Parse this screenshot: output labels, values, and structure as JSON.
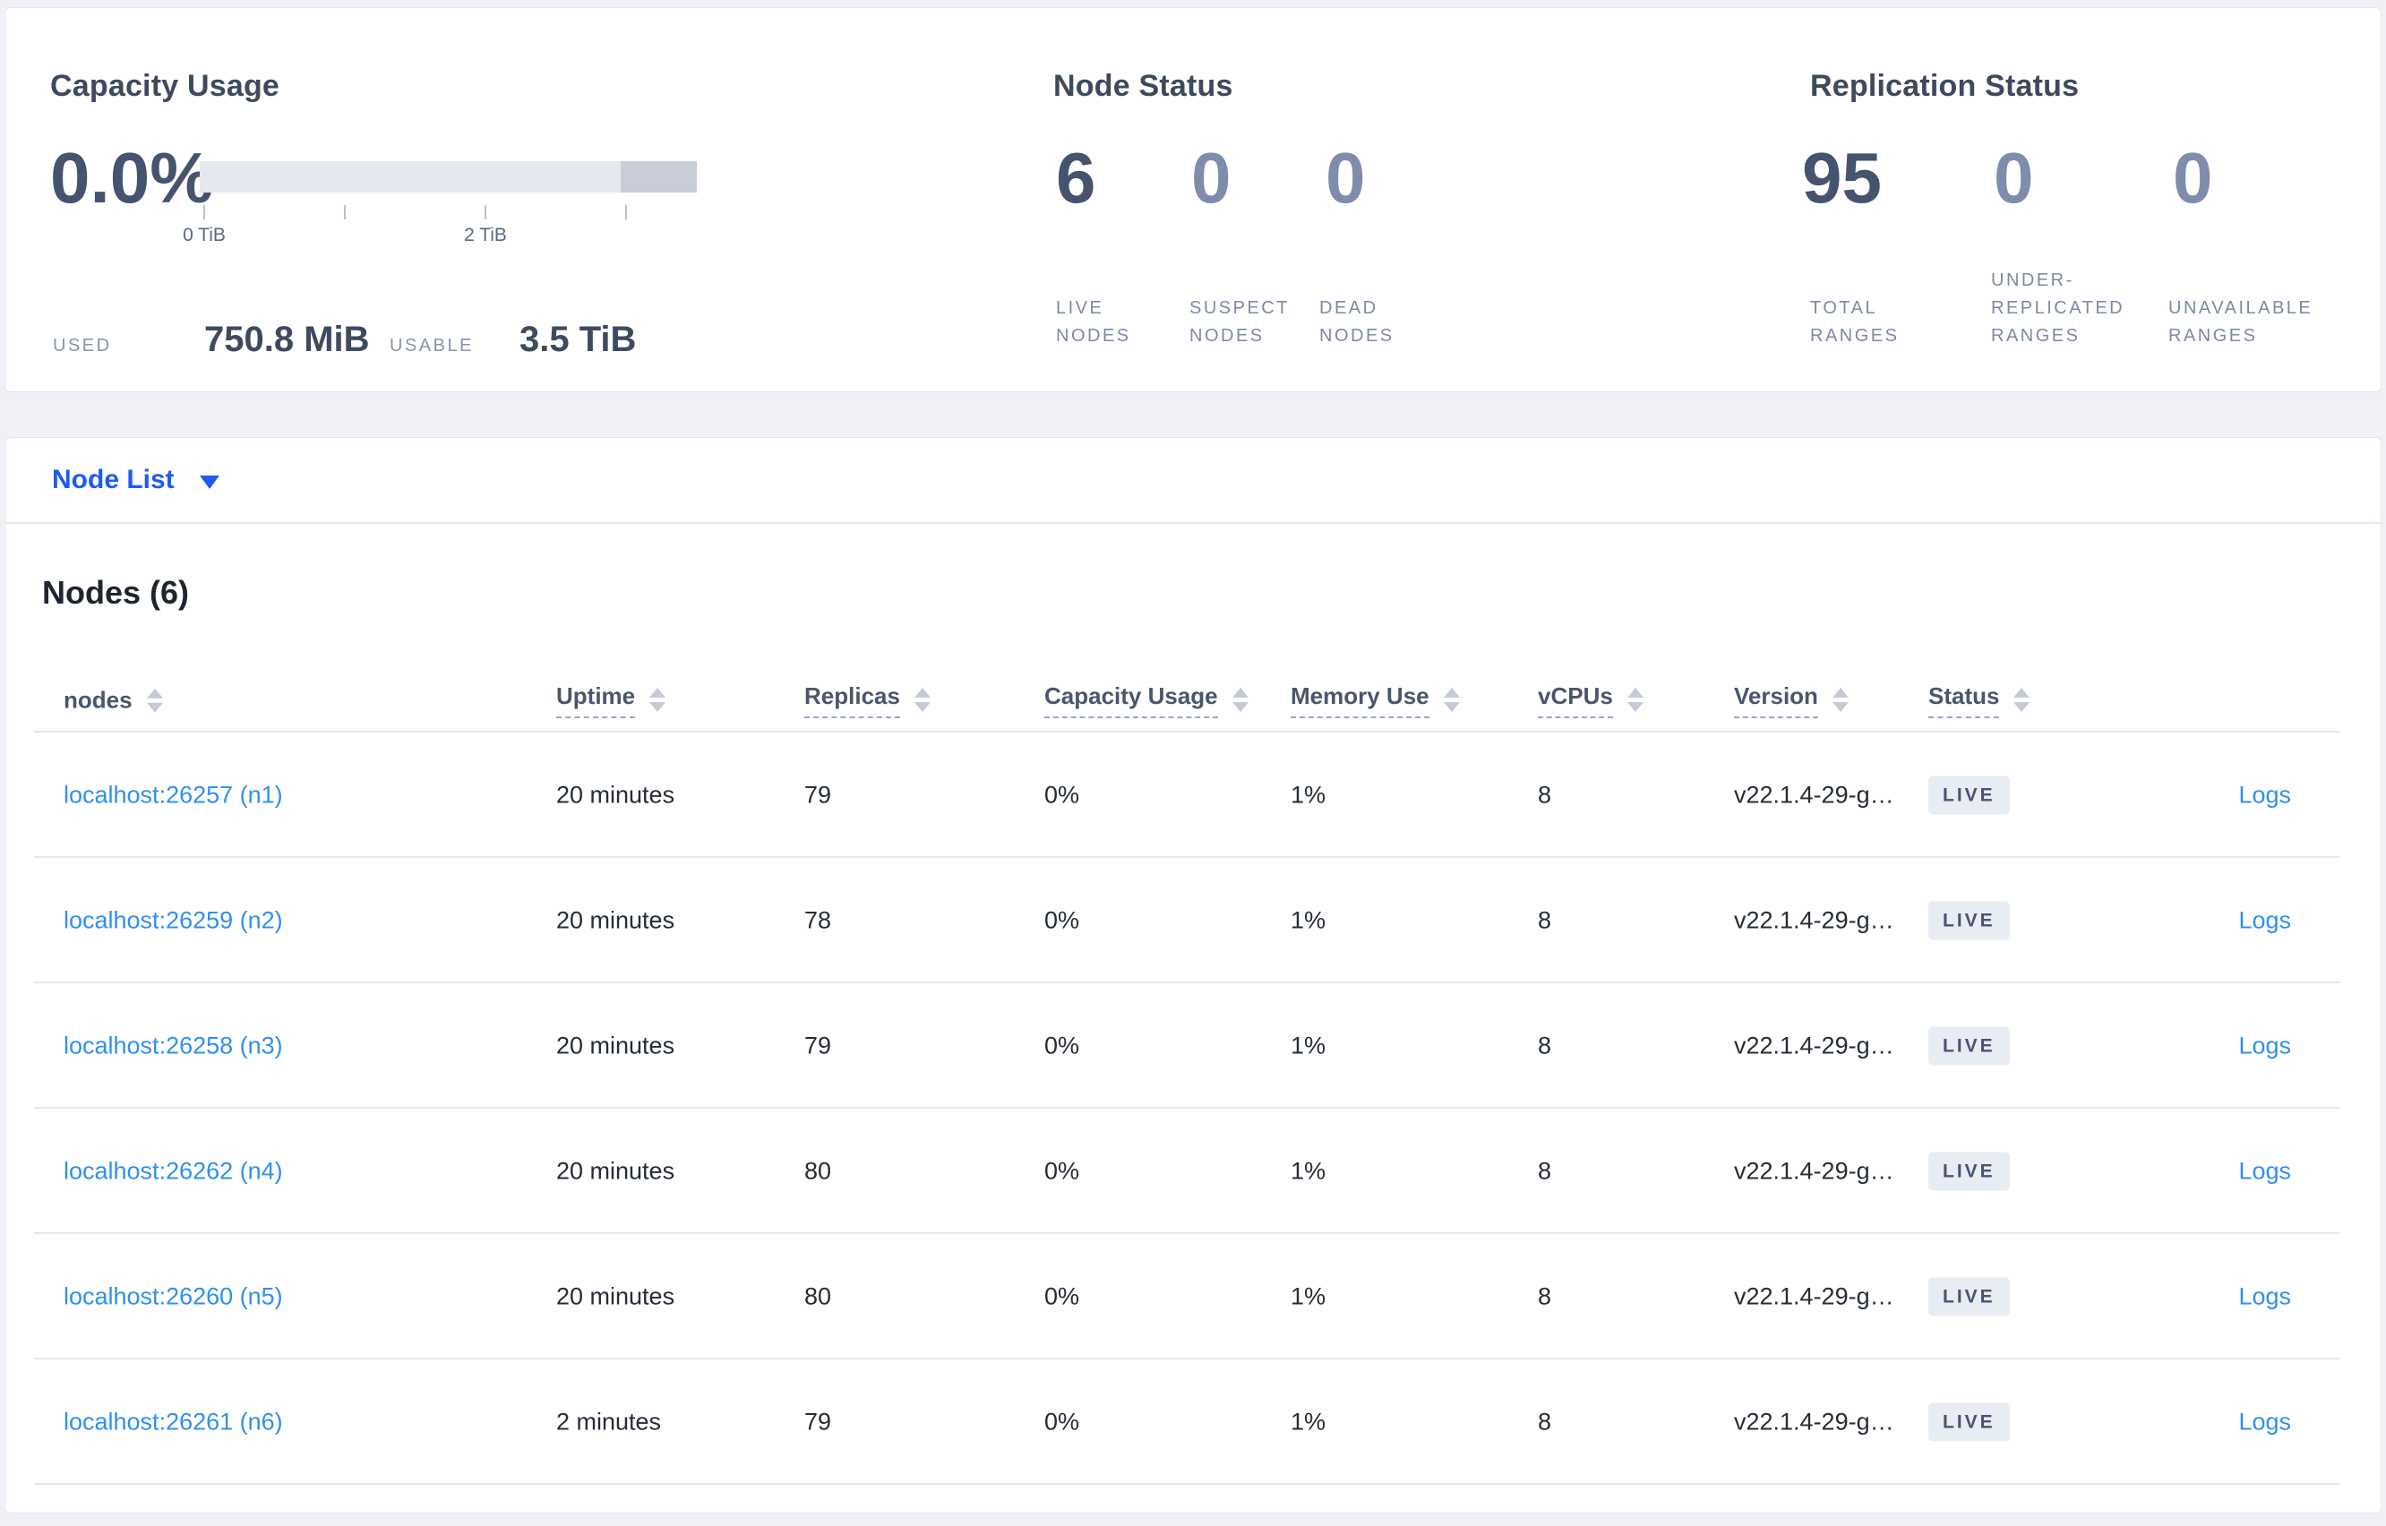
{
  "summary": {
    "capacity": {
      "title": "Capacity Usage",
      "percent": "0.0%",
      "axis_ticks": [
        "0 TiB",
        "2 TiB"
      ],
      "used_label": "USED",
      "used_value": "750.8 MiB",
      "usable_label": "USABLE",
      "usable_value": "3.5 TiB"
    },
    "node_status": {
      "title": "Node Status",
      "stats": [
        {
          "value": "6",
          "label": "LIVE NODES"
        },
        {
          "value": "0",
          "label": "SUSPECT NODES"
        },
        {
          "value": "0",
          "label": "DEAD NODES"
        }
      ]
    },
    "replication": {
      "title": "Replication Status",
      "stats": [
        {
          "value": "95",
          "label": "TOTAL RANGES"
        },
        {
          "value": "0",
          "label": "UNDER-REPLICATED RANGES"
        },
        {
          "value": "0",
          "label": "UNAVAILABLE RANGES"
        }
      ]
    }
  },
  "node_list": {
    "label": "Node List"
  },
  "nodes_table": {
    "title": "Nodes (6)",
    "columns": [
      {
        "label": "nodes"
      },
      {
        "label": "Uptime"
      },
      {
        "label": "Replicas"
      },
      {
        "label": "Capacity Usage"
      },
      {
        "label": "Memory Use"
      },
      {
        "label": "vCPUs"
      },
      {
        "label": "Version"
      },
      {
        "label": "Status"
      }
    ],
    "rows": [
      {
        "node": "localhost:26257 (n1)",
        "uptime": "20 minutes",
        "replicas": "79",
        "capacity_usage": "0%",
        "memory_use": "1%",
        "vcpus": "8",
        "version": "v22.1.4-29-g…",
        "status": "LIVE",
        "logs_label": "Logs"
      },
      {
        "node": "localhost:26259 (n2)",
        "uptime": "20 minutes",
        "replicas": "78",
        "capacity_usage": "0%",
        "memory_use": "1%",
        "vcpus": "8",
        "version": "v22.1.4-29-g…",
        "status": "LIVE",
        "logs_label": "Logs"
      },
      {
        "node": "localhost:26258 (n3)",
        "uptime": "20 minutes",
        "replicas": "79",
        "capacity_usage": "0%",
        "memory_use": "1%",
        "vcpus": "8",
        "version": "v22.1.4-29-g…",
        "status": "LIVE",
        "logs_label": "Logs"
      },
      {
        "node": "localhost:26262 (n4)",
        "uptime": "20 minutes",
        "replicas": "80",
        "capacity_usage": "0%",
        "memory_use": "1%",
        "vcpus": "8",
        "version": "v22.1.4-29-g…",
        "status": "LIVE",
        "logs_label": "Logs"
      },
      {
        "node": "localhost:26260 (n5)",
        "uptime": "20 minutes",
        "replicas": "80",
        "capacity_usage": "0%",
        "memory_use": "1%",
        "vcpus": "8",
        "version": "v22.1.4-29-g…",
        "status": "LIVE",
        "logs_label": "Logs"
      },
      {
        "node": "localhost:26261 (n6)",
        "uptime": "2 minutes",
        "replicas": "79",
        "capacity_usage": "0%",
        "memory_use": "1%",
        "vcpus": "8",
        "version": "v22.1.4-29-g…",
        "status": "LIVE",
        "logs_label": "Logs"
      }
    ]
  },
  "colors": {
    "accent_blue": "#1f5af2",
    "link_blue": "#2f90f0",
    "stat_primary": "#46536e",
    "stat_dim": "#7f8cab",
    "badge_bg": "#e8ecf3",
    "page_bg": "#eff1f6"
  }
}
